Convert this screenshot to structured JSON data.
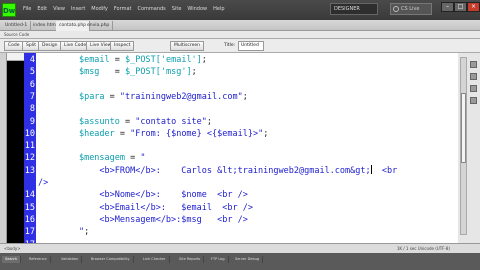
{
  "app": {
    "logo": "Dw",
    "menus": [
      "File",
      "Edit",
      "View",
      "Insert",
      "Modify",
      "Format",
      "Commands",
      "Site",
      "Window",
      "Help"
    ],
    "workspace": "DESIGNER",
    "search_placeholder": "CS Live"
  },
  "tabs": [
    "Untitled-1",
    "index.html",
    "contato.php",
    "envia.php"
  ],
  "related_files": "Source Code",
  "toolbar": {
    "buttons": [
      "Code",
      "Split",
      "Design",
      "Live Code",
      "Live View",
      "Inspect",
      "Multiscreen"
    ],
    "title_label": "Title:",
    "title_value": "Untitled"
  },
  "address": "file:///C|/xampp/htdocs/trainingweb/envia.php",
  "code": {
    "lines": [
      {
        "n": "4",
        "parts": [
          {
            "t": "        "
          },
          {
            "c": "var",
            "t": "$email"
          },
          {
            "t": " = "
          },
          {
            "c": "var",
            "t": "$_POST['email']"
          },
          {
            "t": ";"
          }
        ]
      },
      {
        "n": "5",
        "parts": [
          {
            "t": "        "
          },
          {
            "c": "var",
            "t": "$msg"
          },
          {
            "t": "   = "
          },
          {
            "c": "var",
            "t": "$_POST['msg']"
          },
          {
            "t": ";"
          }
        ]
      },
      {
        "n": "6",
        "parts": []
      },
      {
        "n": "7",
        "parts": [
          {
            "t": "        "
          },
          {
            "c": "var",
            "t": "$para"
          },
          {
            "t": " = "
          },
          {
            "c": "str",
            "t": "\"trainingweb2@gmail.com\""
          },
          {
            "t": ";"
          }
        ]
      },
      {
        "n": "8",
        "parts": []
      },
      {
        "n": "9",
        "parts": [
          {
            "t": "        "
          },
          {
            "c": "var",
            "t": "$assunto"
          },
          {
            "t": " = "
          },
          {
            "c": "str",
            "t": "\"contato site\""
          },
          {
            "t": ";"
          }
        ]
      },
      {
        "n": "10",
        "parts": [
          {
            "t": "        "
          },
          {
            "c": "var",
            "t": "$header"
          },
          {
            "t": " = "
          },
          {
            "c": "str",
            "t": "\"From: {$nome} <{$email}>\""
          },
          {
            "t": ";"
          }
        ]
      },
      {
        "n": "11",
        "parts": []
      },
      {
        "n": "12",
        "parts": [
          {
            "t": "        "
          },
          {
            "c": "var",
            "t": "$mensagem"
          },
          {
            "t": " = "
          },
          {
            "c": "str",
            "t": "\""
          }
        ]
      },
      {
        "n": "13",
        "parts": [
          {
            "c": "str",
            "t": "            <b>FROM</b>:    Carlos &lt;trainingweb2@gmail.com&gt;"
          },
          {
            "cursor": true
          },
          {
            "c": "str",
            "t": "  <br"
          }
        ]
      },
      {
        "n": "",
        "parts": [
          {
            "c": "str",
            "t": "/>"
          }
        ]
      },
      {
        "n": "14",
        "parts": [
          {
            "c": "str",
            "t": "            <b>Nome</b>:    $nome  <br />"
          }
        ]
      },
      {
        "n": "15",
        "parts": [
          {
            "c": "str",
            "t": "            <b>Email</b>:   $email  <br />"
          }
        ]
      },
      {
        "n": "16",
        "parts": [
          {
            "c": "str",
            "t": "            <b>Mensagem</b>:$msg   <br />"
          }
        ]
      },
      {
        "n": "17",
        "parts": [
          {
            "c": "str",
            "t": "        \""
          },
          {
            "t": ";"
          }
        ]
      },
      {
        "n": "17",
        "parts": []
      }
    ]
  },
  "status": {
    "left": "<body>",
    "right": "1K / 1 sec  Unicode (UTF-8)"
  },
  "panels": [
    "Search",
    "Reference",
    "Validation",
    "Browser Compatibility",
    "Link Checker",
    "Site Reports",
    "FTP Log",
    "Server Debug"
  ],
  "colors": {
    "gutter": "#2f2fe6",
    "string": "#1c1ccf",
    "variable": "#0c9fae"
  }
}
